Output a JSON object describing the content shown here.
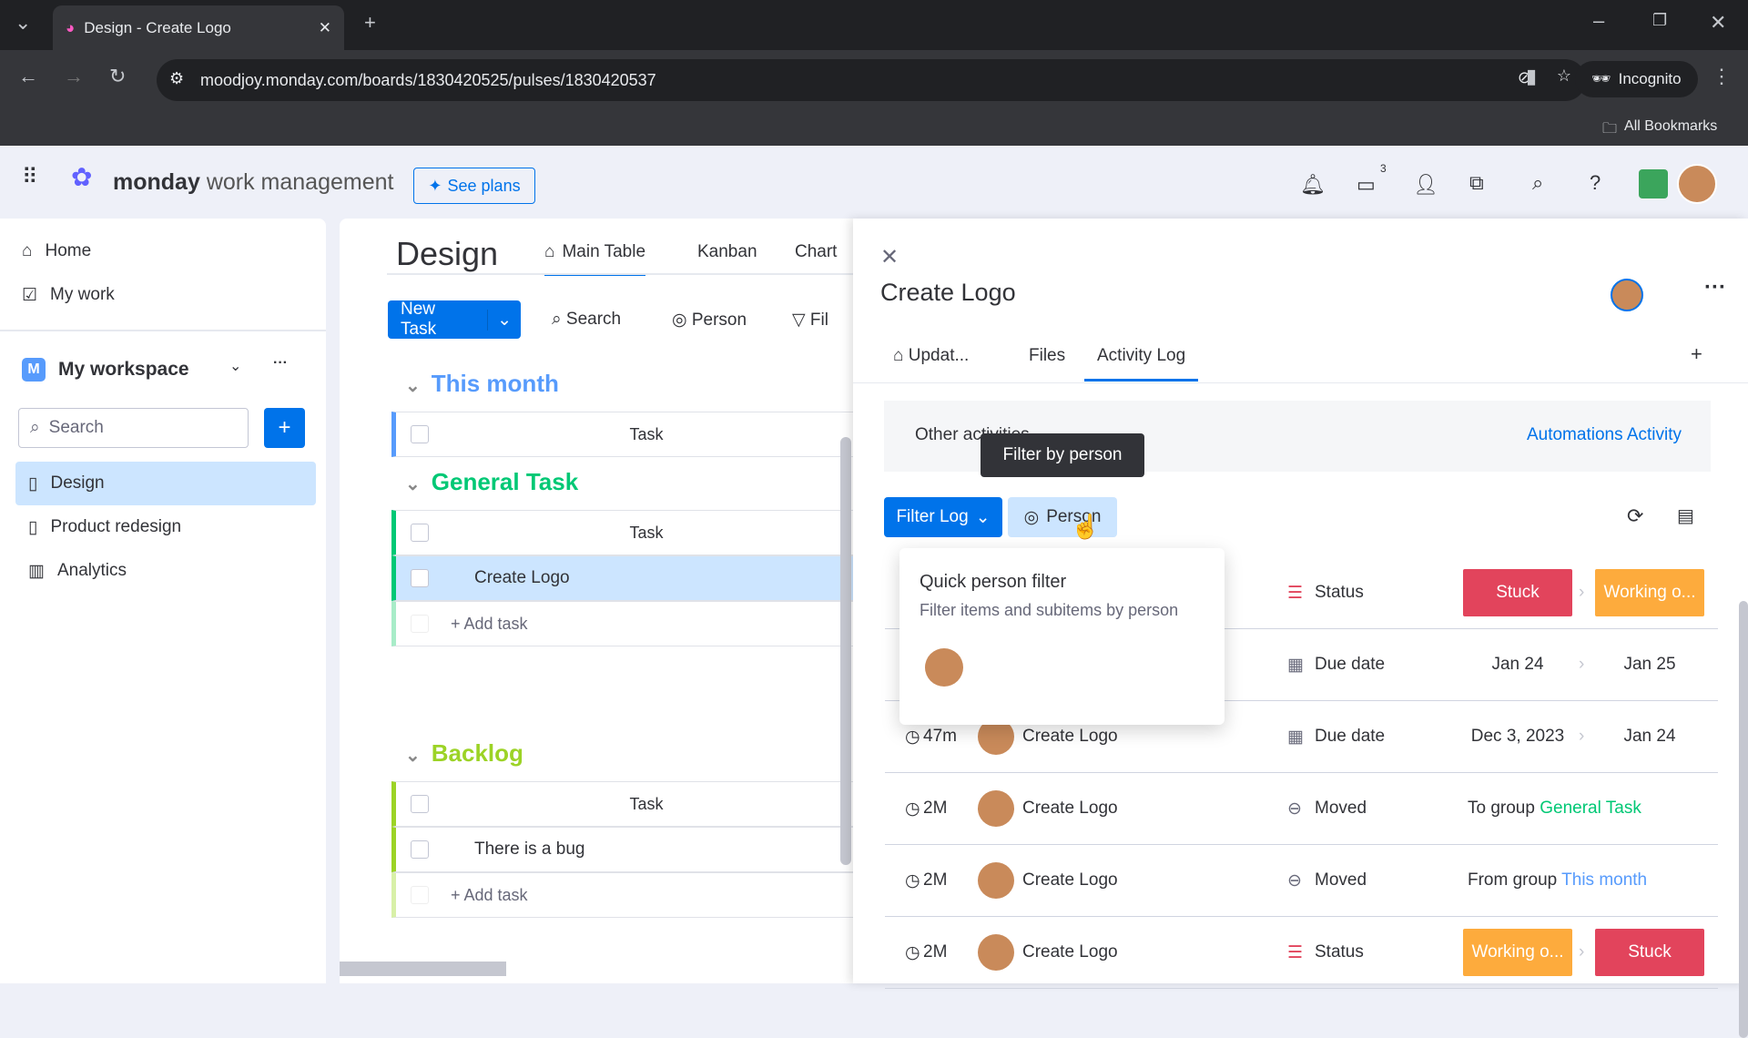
{
  "browser": {
    "tab_title": "Design - Create Logo",
    "url": "moodjoy.monday.com/boards/1830420525/pulses/1830420537",
    "incognito": "Incognito",
    "bookmarks": "All Bookmarks"
  },
  "header": {
    "brand_bold": "monday",
    "brand_light": "work management",
    "see_plans": "See plans",
    "inbox_badge": "3"
  },
  "sidebar": {
    "home": "Home",
    "my_work": "My work",
    "workspace": "My workspace",
    "workspace_initial": "M",
    "search_placeholder": "Search",
    "boards": [
      {
        "label": "Design",
        "active": true
      },
      {
        "label": "Product redesign"
      },
      {
        "label": "Analytics"
      }
    ]
  },
  "board": {
    "title": "Design",
    "views": [
      "Main Table",
      "Kanban",
      "Chart"
    ],
    "new_task": "New Task",
    "search": "Search",
    "person": "Person",
    "filter": "Fil",
    "groups": [
      {
        "name": "This month",
        "color": "#579bfc",
        "header": "Task",
        "items": []
      },
      {
        "name": "General Task",
        "color": "#00c875",
        "header": "Task",
        "items": [
          "Create Logo"
        ],
        "add": "+ Add task"
      },
      {
        "name": "Backlog",
        "color": "#9cd326",
        "header": "Task",
        "items": [
          "There is a bug"
        ],
        "add": "+ Add task"
      }
    ]
  },
  "panel": {
    "title": "Create Logo",
    "tabs": [
      "Updat...",
      "Files",
      "Activity Log"
    ],
    "active_tab": "Activity Log",
    "other_activities": "Other activities",
    "automations": "Automations Activity",
    "filter_log": "Filter Log",
    "person": "Person",
    "tooltip": "Filter by person",
    "popup": {
      "title": "Quick person filter",
      "subtitle": "Filter items and subitems by person"
    },
    "rows": [
      {
        "time": "",
        "item": "",
        "type": "Status",
        "from": "Stuck",
        "to": "Working o...",
        "from_color": "#e2445c",
        "to_color": "#fdab3d"
      },
      {
        "time": "",
        "item": "",
        "type": "Due date",
        "from": "Jan 24",
        "to": "Jan 25"
      },
      {
        "time": "47m",
        "item": "Create Logo",
        "type": "Due date",
        "from": "Dec 3, 2023",
        "to": "Jan 24"
      },
      {
        "time": "2M",
        "item": "Create Logo",
        "type": "Moved",
        "prefix": "To group",
        "group": "General Task",
        "group_color": "#00c875"
      },
      {
        "time": "2M",
        "item": "Create Logo",
        "type": "Moved",
        "prefix": "From group",
        "group": "This month",
        "group_color": "#579bfc"
      },
      {
        "time": "2M",
        "item": "Create Logo",
        "type": "Status",
        "from": "Working o...",
        "to": "Stuck",
        "from_color": "#fdab3d",
        "to_color": "#e2445c"
      }
    ]
  }
}
